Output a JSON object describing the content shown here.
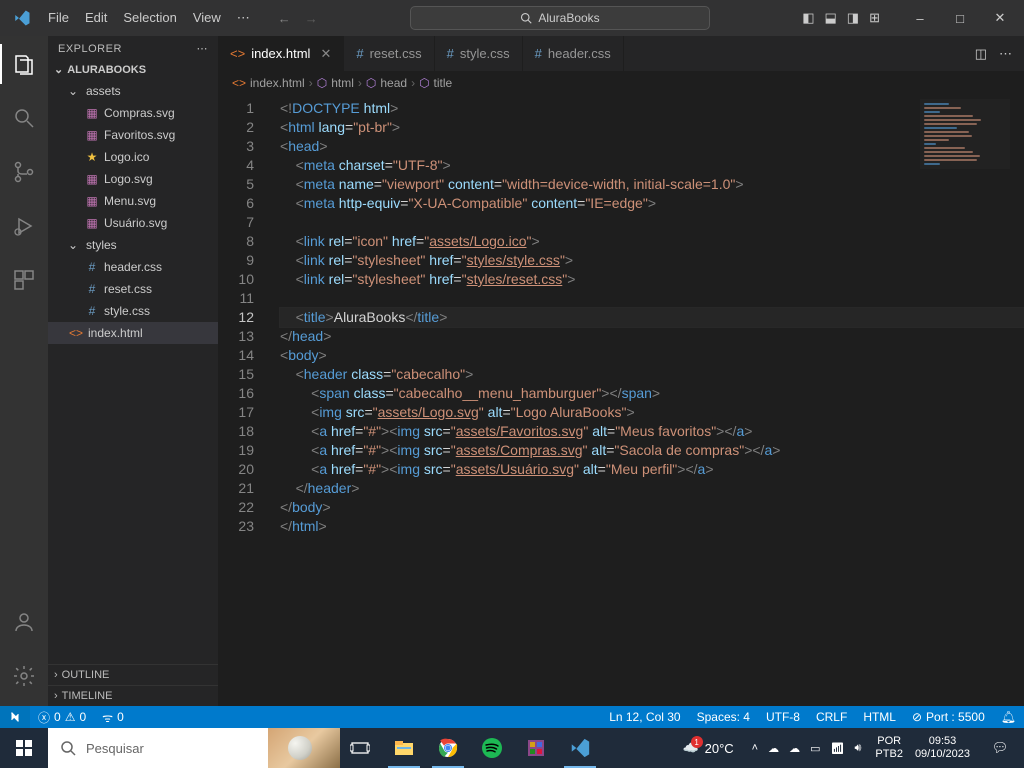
{
  "titlebar": {
    "menu": [
      "File",
      "Edit",
      "Selection",
      "View"
    ],
    "search_text": "AluraBooks"
  },
  "sidebar": {
    "title": "EXPLORER",
    "project": "ALURABOOKS",
    "tree": [
      {
        "type": "folder",
        "name": "assets",
        "level": 1,
        "open": true
      },
      {
        "type": "file",
        "name": "Compras.svg",
        "level": 2,
        "icon": "svg"
      },
      {
        "type": "file",
        "name": "Favoritos.svg",
        "level": 2,
        "icon": "svg"
      },
      {
        "type": "file",
        "name": "Logo.ico",
        "level": 2,
        "icon": "star"
      },
      {
        "type": "file",
        "name": "Logo.svg",
        "level": 2,
        "icon": "svg"
      },
      {
        "type": "file",
        "name": "Menu.svg",
        "level": 2,
        "icon": "svg"
      },
      {
        "type": "file",
        "name": "Usuário.svg",
        "level": 2,
        "icon": "svg"
      },
      {
        "type": "folder",
        "name": "styles",
        "level": 1,
        "open": true
      },
      {
        "type": "file",
        "name": "header.css",
        "level": 2,
        "icon": "css"
      },
      {
        "type": "file",
        "name": "reset.css",
        "level": 2,
        "icon": "css"
      },
      {
        "type": "file",
        "name": "style.css",
        "level": 2,
        "icon": "css"
      },
      {
        "type": "file",
        "name": "index.html",
        "level": 1,
        "icon": "html",
        "selected": true
      }
    ],
    "sections": [
      "OUTLINE",
      "TIMELINE"
    ]
  },
  "tabs": [
    {
      "name": "index.html",
      "icon": "html",
      "active": true,
      "close": true
    },
    {
      "name": "reset.css",
      "icon": "css"
    },
    {
      "name": "style.css",
      "icon": "css"
    },
    {
      "name": "header.css",
      "icon": "css"
    }
  ],
  "breadcrumb": [
    {
      "icon": "html",
      "text": "index.html"
    },
    {
      "icon": "tag",
      "text": "html"
    },
    {
      "icon": "tag",
      "text": "head"
    },
    {
      "icon": "tag",
      "text": "title"
    }
  ],
  "code_lines": 23,
  "current_line": 12,
  "statusbar": {
    "errors": "0",
    "warnings": "0",
    "port_icon": "0",
    "ln_col": "Ln 12, Col 30",
    "spaces": "Spaces: 4",
    "encoding": "UTF-8",
    "eol": "CRLF",
    "lang": "HTML",
    "port": "Port : 5500"
  },
  "taskbar": {
    "search_placeholder": "Pesquisar",
    "weather": "20°C",
    "lang1": "POR",
    "lang2": "PTB2",
    "time": "09:53",
    "date": "09/10/2023"
  }
}
